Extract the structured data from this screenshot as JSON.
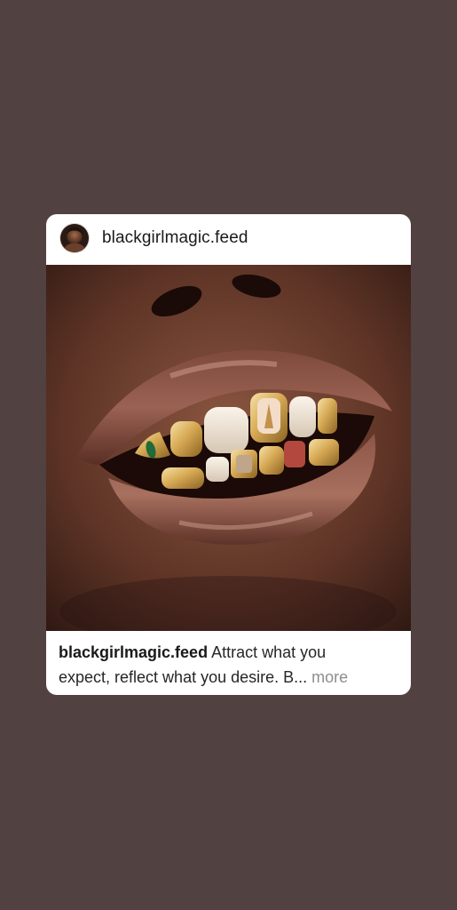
{
  "post": {
    "username": "blackgirlmagic.feed",
    "avatar_icon": "profile-photo",
    "image_description_icon": "photo-gold-grillz-smile",
    "caption_author": "blackgirlmagic.feed",
    "caption_text_line1": "Attract what you",
    "caption_text_line2": "expect, reflect what you desire. B",
    "caption_ellipsis": "...",
    "more_label": "more"
  },
  "colors": {
    "background": "#514141",
    "card": "#ffffff",
    "text": "#262626",
    "muted": "#8e8e8e"
  }
}
